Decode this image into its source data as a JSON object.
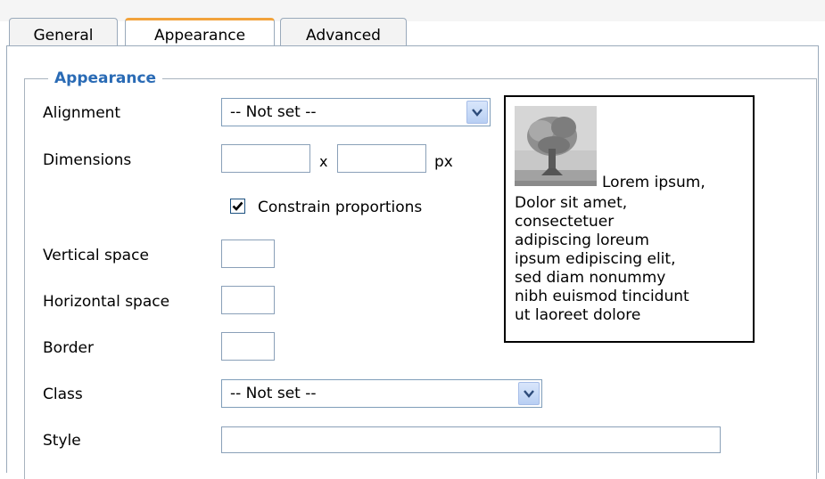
{
  "tabs": [
    {
      "label": "General",
      "active": false
    },
    {
      "label": "Appearance",
      "active": true
    },
    {
      "label": "Advanced",
      "active": false
    }
  ],
  "fieldset": {
    "legend": "Appearance",
    "alignment": {
      "label": "Alignment",
      "value": "-- Not set --"
    },
    "dimensions": {
      "label": "Dimensions",
      "width": "",
      "height": "",
      "separator": "x",
      "unit": "px"
    },
    "constrain": {
      "label": "Constrain proportions",
      "checked": true
    },
    "vertical_space": {
      "label": "Vertical space",
      "value": ""
    },
    "horizontal_space": {
      "label": "Horizontal space",
      "value": ""
    },
    "border": {
      "label": "Border",
      "value": ""
    },
    "class": {
      "label": "Class",
      "value": "-- Not set --"
    },
    "style": {
      "label": "Style",
      "value": ""
    }
  },
  "preview": {
    "image": "tree-thumbnail",
    "first_line": "Lorem ipsum,",
    "lines": [
      "Dolor sit amet,",
      "consectetuer",
      "adipiscing loreum",
      "ipsum edipiscing elit,",
      "sed diam nonummy",
      "nibh euismod tincidunt",
      "ut laoreet dolore"
    ]
  },
  "colors": {
    "legend": "#2a6bb5",
    "active_tab_accent": "#f2a33c",
    "border": "#9aaabb"
  }
}
